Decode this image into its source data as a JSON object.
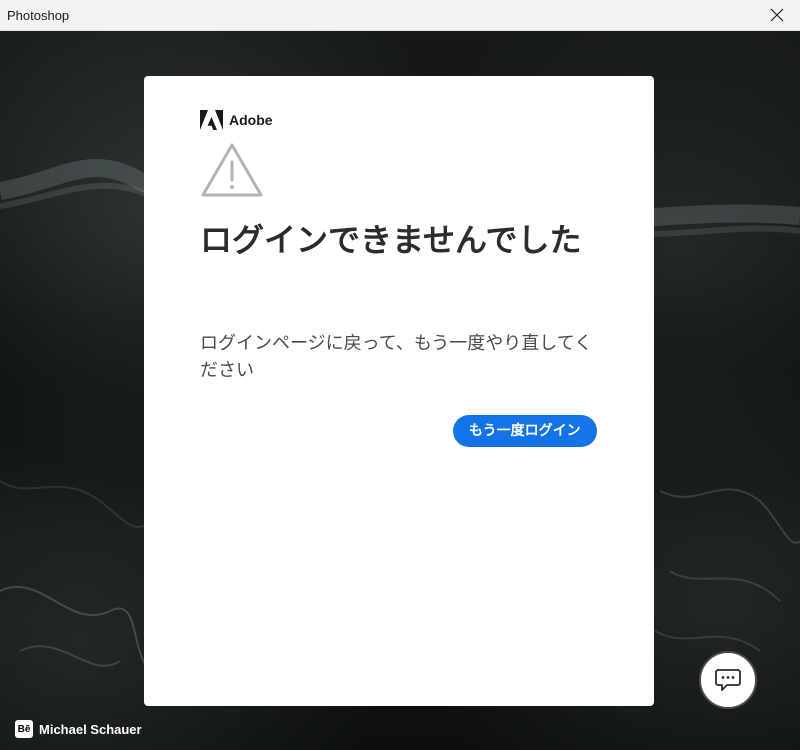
{
  "window": {
    "title": "Photoshop",
    "close_icon": "close-icon"
  },
  "card": {
    "brand_name": "Adobe",
    "brand_icon": "adobe-logo-icon",
    "status_icon": "warning-triangle-icon",
    "heading": "ログインできませんでした",
    "message": "ログインページに戻って、もう一度やり直してください",
    "retry_button_label": "もう一度ログイン",
    "accent_color": "#1473e6"
  },
  "background": {
    "credit_icon": "behance-icon",
    "credit_icon_text": "Bē",
    "credit_name": "Michael Schauer"
  },
  "feedback": {
    "icon": "chat-bubble-icon"
  }
}
